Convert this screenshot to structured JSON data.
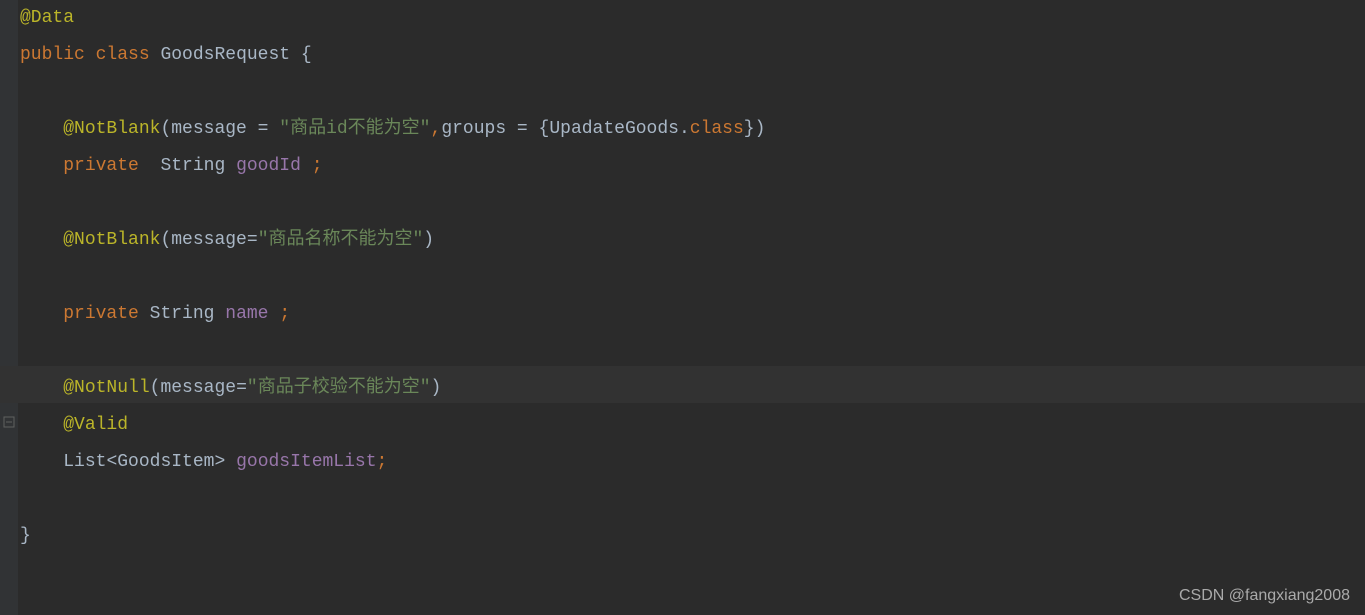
{
  "code": {
    "line1": {
      "annotation": "@Data"
    },
    "line2": {
      "public": "public",
      "class": "class",
      "className": "GoodsRequest",
      "brace": "{"
    },
    "line4": {
      "annotation": "@NotBlank",
      "lparen": "(",
      "message": "message",
      "eq1": " = ",
      "string": "\"商品id不能为空\"",
      "comma": ",",
      "groups": "groups",
      "eq2": " = ",
      "lbrace": "{",
      "upadateGoods": "UpadateGoods",
      "dot": ".",
      "classKw": "class",
      "rbrace": "}",
      "rparen": ")"
    },
    "line5": {
      "private": "private",
      "type": "String",
      "field": "goodId",
      "semi": ";"
    },
    "line7": {
      "annotation": "@NotBlank",
      "lparen": "(",
      "message": "message",
      "eq": "=",
      "string": "\"商品名称不能为空\"",
      "rparen": ")"
    },
    "line9": {
      "private": "private",
      "type": "String",
      "field": "name",
      "semi": ";"
    },
    "line11": {
      "annotation": "@NotNull",
      "lparen": "(",
      "message": "message",
      "eq": "=",
      "string": "\"商品子校验不能为空\"",
      "rparen": ")"
    },
    "line12": {
      "annotation": "@Valid"
    },
    "line13": {
      "list": "List",
      "lt": "<",
      "itemType": "GoodsItem",
      "gt": ">",
      "field": "goodsItemList",
      "semi": ";"
    },
    "line15": {
      "rbrace": "}"
    }
  },
  "watermark": "CSDN @fangxiang2008"
}
